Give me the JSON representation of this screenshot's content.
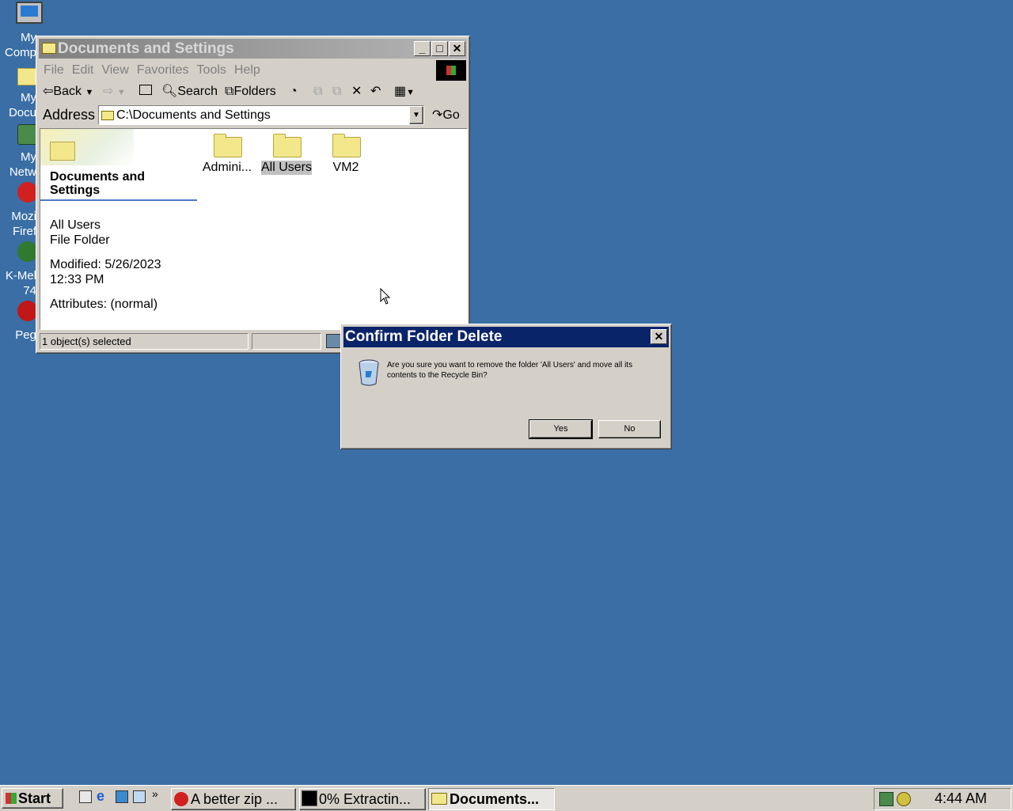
{
  "desktop": {
    "icons": [
      {
        "label1": "My",
        "label2": "Comp"
      },
      {
        "label1": "My",
        "label2": "Docu"
      },
      {
        "label1": "My",
        "label2": "Netw"
      },
      {
        "label1": "Mozi",
        "label2": "Firef"
      },
      {
        "label1": "K-Mel",
        "label2": "74"
      },
      {
        "label1": "Peg",
        "label2": ""
      }
    ]
  },
  "explorer": {
    "title": "Documents and Settings",
    "menu": [
      "File",
      "Edit",
      "View",
      "Favorites",
      "Tools",
      "Help"
    ],
    "toolbar": {
      "back": "Back",
      "search": "Search",
      "folders": "Folders"
    },
    "address": {
      "label": "Address",
      "value": "C:\\Documents and Settings",
      "go": "Go"
    },
    "side_panel": {
      "heading": "Documents and Settings",
      "item_name": "All Users",
      "item_type": "File Folder",
      "modified_label": "Modified: 5/26/2023",
      "modified_time": "12:33 PM",
      "attributes": "Attributes: (normal)"
    },
    "folders": [
      {
        "name": "Admini..."
      },
      {
        "name": "All Users"
      },
      {
        "name": "VM2"
      }
    ],
    "status": "1 object(s) selected"
  },
  "dialog": {
    "title": "Confirm Folder Delete",
    "message": "Are you sure you want to remove the folder 'All Users' and move all its contents to the Recycle Bin?",
    "yes": "Yes",
    "no": "No"
  },
  "taskbar": {
    "start": "Start",
    "tasks": [
      {
        "label": "A better zip ..."
      },
      {
        "label": "0% Extractin..."
      },
      {
        "label": "Documents..."
      }
    ],
    "clock": "4:44 AM",
    "overflow": "»"
  },
  "colors": {
    "desktop": "#3a6ea5",
    "active_title": "#0a246a",
    "inactive_title": "#808080",
    "face": "#d4d0c8"
  }
}
